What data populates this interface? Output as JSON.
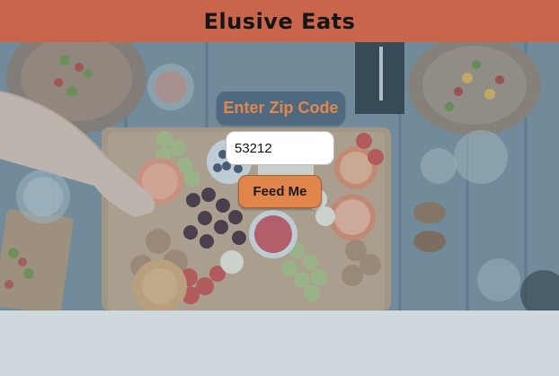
{
  "header": {
    "title": "Elusive Eats"
  },
  "form": {
    "zip_label": "Enter Zip Code",
    "zip_value": "53212",
    "submit_label": "Feed Me"
  },
  "hero": {
    "image": "food-platter-photo"
  },
  "colors": {
    "header_bg": "#c8654a",
    "label_bg": "#4f6a7f",
    "label_text": "#e2884f",
    "button_bg": "#e0854c",
    "page_bg": "#cfd9dd"
  }
}
